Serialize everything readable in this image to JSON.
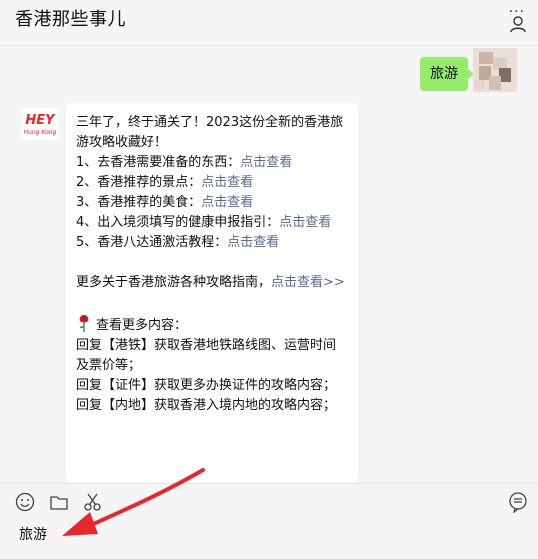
{
  "header": {
    "title": "香港那些事儿",
    "more_label": "..."
  },
  "outgoing_message": {
    "text": "旅游"
  },
  "incoming_message": {
    "intro_line": "三年了，终于通关了！2023这份全新的香港旅游攻略收藏好！",
    "items": [
      {
        "text": "1、去香港需要准备的东西：",
        "link": "点击查看"
      },
      {
        "text": "2、香港推荐的景点：",
        "link": "点击查看"
      },
      {
        "text": "3、香港推荐的美食：",
        "link": "点击查看"
      },
      {
        "text": "4、出入境须填写的健康申报指引：",
        "link": "点击查看"
      },
      {
        "text": "5、香港八达通激活教程：",
        "link": "点击查看"
      }
    ],
    "more_guides": {
      "text": "更多关于香港旅游各种攻略指南，",
      "link": "点击查看>>"
    },
    "more_content_title": "查看更多内容：",
    "replies": [
      "回复【港铁】获取香港地铁路线图、运营时间及票价等；",
      "回复【证件】获取更多办换证件的攻略内容；",
      "回复【内地】获取香港入境内地的攻略内容；"
    ]
  },
  "input": {
    "draft": "旅游"
  },
  "icons": {
    "more": "more-dots-icon",
    "contact": "person-icon",
    "emoji": "emoji-icon",
    "folder": "folder-icon",
    "scissors": "scissors-icon",
    "chat_history": "chat-bubble-icon",
    "rose": "rose-icon"
  },
  "colors": {
    "outgoing_bubble": "#95ec69",
    "link": "#576b95",
    "annotation_arrow": "#e8262d"
  }
}
